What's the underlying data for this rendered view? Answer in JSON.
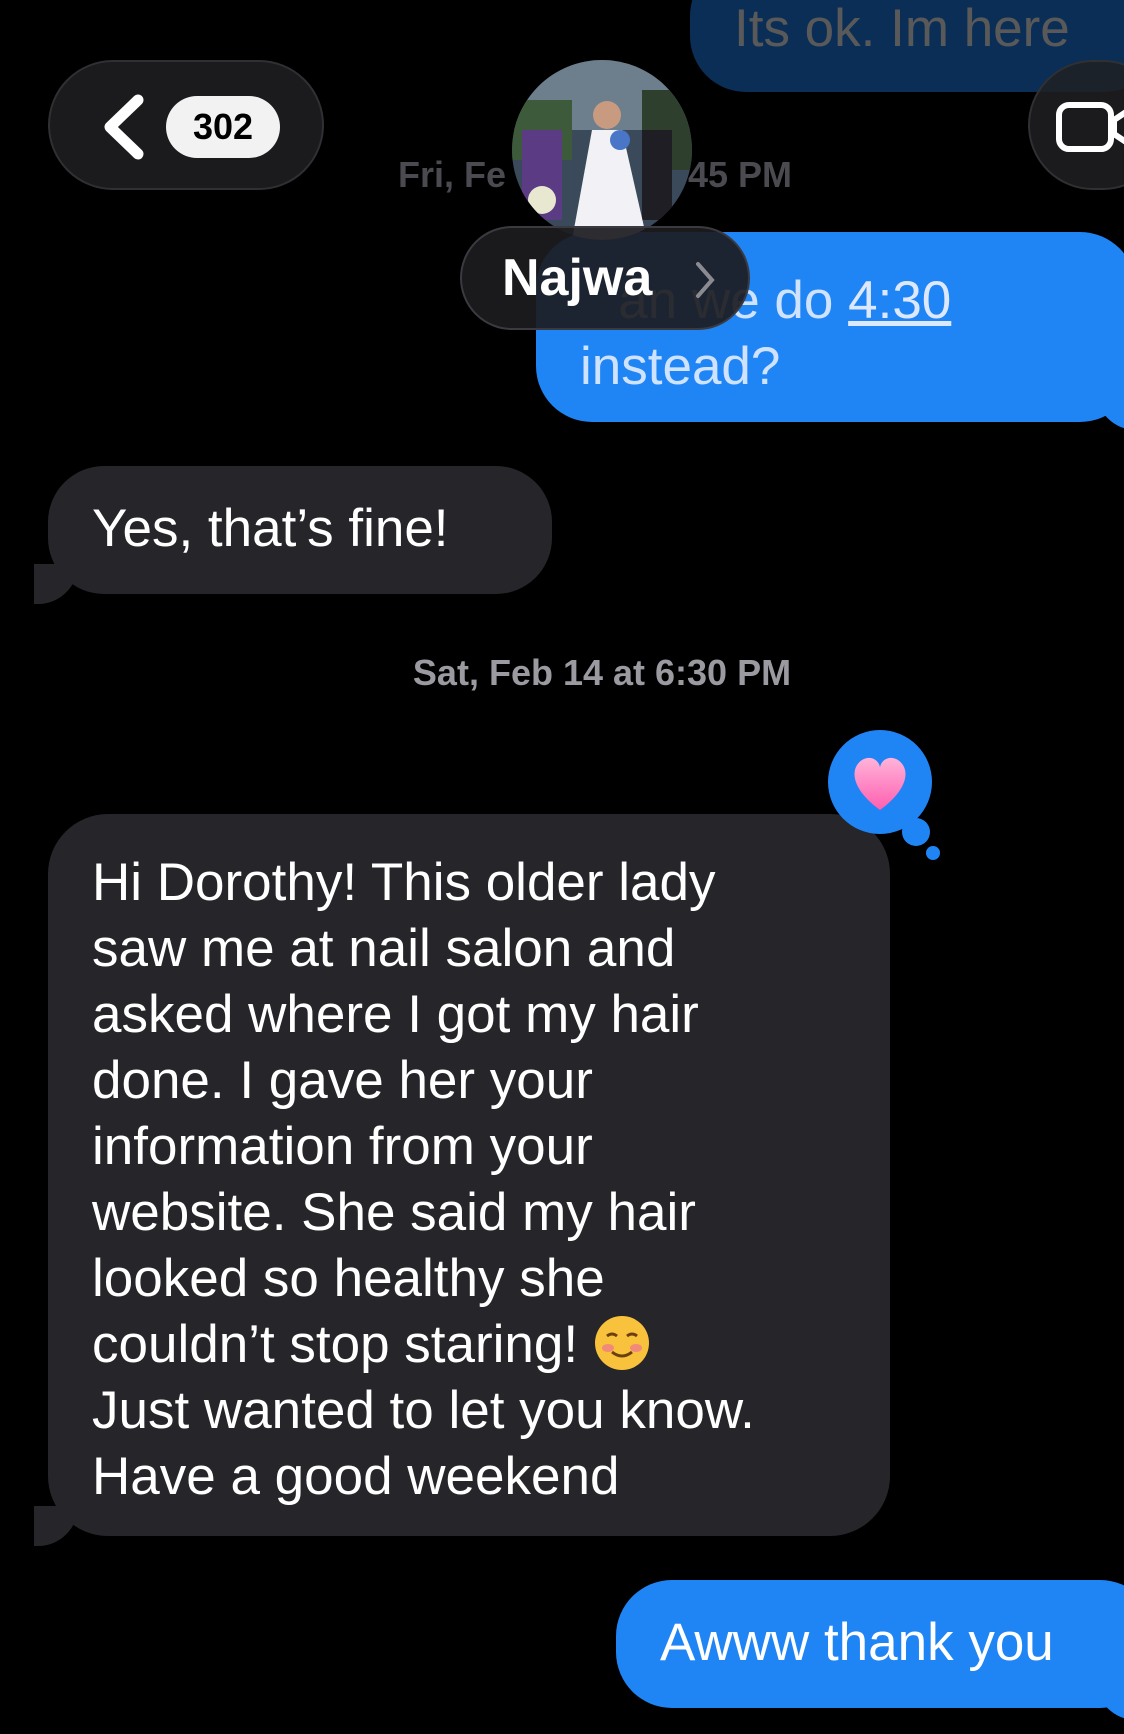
{
  "header": {
    "back_count": "302",
    "contact_name": "Najwa"
  },
  "messages": {
    "top_partial": "Its ok. Im here",
    "timestamp_1": "Fri, Feb 13 at 1:45 PM",
    "timestamp_1_left": "Fri, Fe",
    "timestamp_1_right": "45 PM",
    "outgoing_1_line1_pre": "an we do ",
    "outgoing_1_time": "4:30",
    "outgoing_1_line2": "instead?",
    "incoming_1": "Yes, that’s fine!",
    "timestamp_2": "Sat, Feb 14 at 6:30 PM",
    "incoming_2_lines": [
      "Hi Dorothy! This older lady",
      "saw me at nail salon and",
      "asked where I got my hair",
      "done. I gave her your",
      "information from your",
      "website. She said my hair",
      "looked so healthy she",
      "couldn’t stop staring!",
      "Just wanted to let you know.",
      "Have a good weekend"
    ],
    "outgoing_2": "Awww thank you"
  },
  "colors": {
    "background": "#000000",
    "incoming_bubble": "#26262a",
    "outgoing_bubble": "#1f85f5",
    "timestamp": "#9a9aa0"
  },
  "icons": {
    "back": "chevron-left-icon",
    "video": "video-camera-icon",
    "reaction": "heart-icon",
    "emoji": "smiling-face-emoji"
  }
}
